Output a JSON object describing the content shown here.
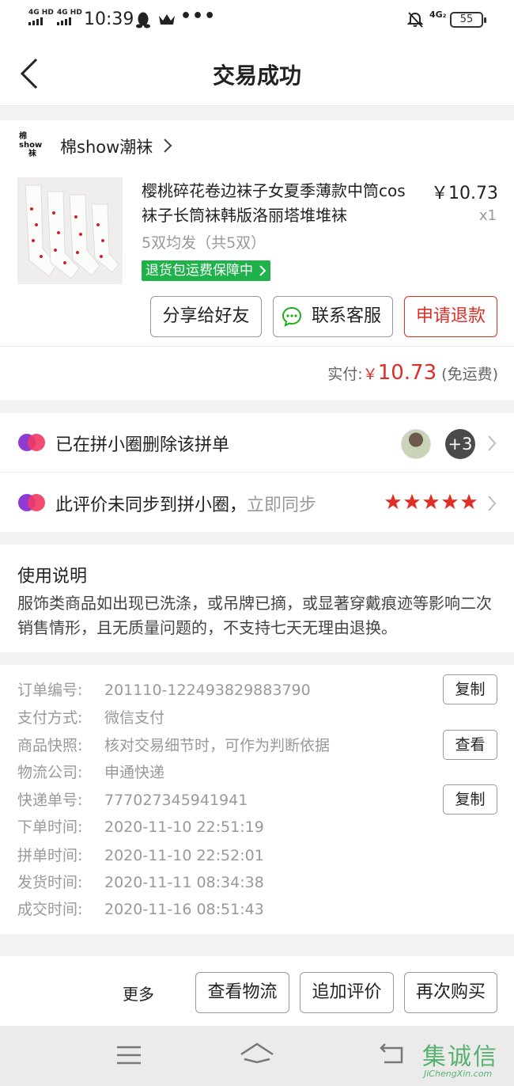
{
  "status_bar": {
    "net1": "4G HD",
    "net2": "4G HD",
    "time": "10:39",
    "dots": "•••",
    "net_right": "4G₂",
    "battery": "55"
  },
  "header": {
    "title": "交易成功"
  },
  "shop": {
    "logo_line1": "棉",
    "logo_line2": "show",
    "logo_line3": "袜",
    "name": "棉show潮袜"
  },
  "product": {
    "title": "樱桃碎花卷边袜子女夏季薄款中筒cos袜子长筒袜韩版洛丽塔堆堆袜",
    "price": "￥10.73",
    "qty": "x1",
    "spec": "5双均发（共5双）",
    "guarantee": "退货包运费保障中"
  },
  "order_buttons": {
    "share": "分享给好友",
    "service": "联系客服",
    "refund": "申请退款"
  },
  "payment": {
    "label": "实付:",
    "currency": "￥",
    "amount": "10.73",
    "shipping": "(免运费)"
  },
  "circle": {
    "row1_text": "已在拼小圈删除该拼单",
    "extra_count": "+3",
    "row2_text": "此评价未同步到拼小圈，",
    "row2_link": "立即同步",
    "rating": 5,
    "star_color": "#e02e24"
  },
  "notice": {
    "title": "使用说明",
    "body": "服饰类商品如出现已洗涤，或吊牌已摘，或显著穿戴痕迹等影响二次销售情形，且无质量问题的，不支持七天无理由退换。"
  },
  "order_info": {
    "rows": [
      {
        "label": "订单编号:",
        "value": "201110-122493829883790"
      },
      {
        "label": "支付方式:",
        "value": "微信支付"
      },
      {
        "label": "商品快照:",
        "value": "核对交易细节时，可作为判断依据"
      },
      {
        "label": "物流公司:",
        "value": "申通快递"
      },
      {
        "label": "快递单号:",
        "value": "777027345941941"
      },
      {
        "label": "下单时间:",
        "value": "2020-11-10 22:51:19"
      },
      {
        "label": "拼单时间:",
        "value": "2020-11-10 22:52:01"
      },
      {
        "label": "发货时间:",
        "value": "2020-11-11 08:34:38"
      },
      {
        "label": "成交时间:",
        "value": "2020-11-16 08:51:43"
      }
    ],
    "copy_label": "复制",
    "view_label": "查看"
  },
  "actions": {
    "more": "更多",
    "logistics": "查看物流",
    "review": "追加评价",
    "rebuy": "再次购买"
  },
  "watermark": {
    "text": "集诚信",
    "sub": "JiChengXin.com"
  },
  "colors": {
    "accent": "#e02e24",
    "green": "#1fb14a",
    "wechat": "#1aad19"
  }
}
